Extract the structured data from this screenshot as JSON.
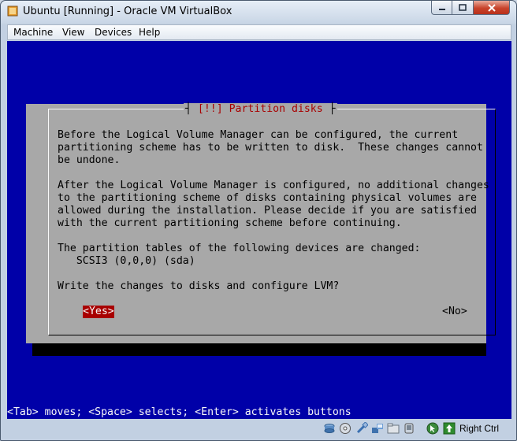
{
  "window": {
    "title": "Ubuntu [Running] - Oracle VM VirtualBox",
    "menu": [
      "Machine",
      "View",
      "Devices",
      "Help"
    ]
  },
  "dialog": {
    "title": "[!!] Partition disks",
    "lines": [
      "Before the Logical Volume Manager can be configured, the current",
      "partitioning scheme has to be written to disk.  These changes cannot",
      "be undone.",
      "",
      "After the Logical Volume Manager is configured, no additional changes",
      "to the partitioning scheme of disks containing physical volumes are",
      "allowed during the installation. Please decide if you are satisfied",
      "with the current partitioning scheme before continuing.",
      "",
      "The partition tables of the following devices are changed:",
      "   SCSI3 (0,0,0) (sda)",
      "",
      "Write the changes to disks and configure LVM?"
    ],
    "yes_label": "<Yes>",
    "no_label": "<No>"
  },
  "help_line": "<Tab> moves; <Space> selects; <Enter> activates buttons",
  "statusbar": {
    "icons": [
      "hard-disk-icon",
      "optical-disk-icon",
      "usb-icon",
      "network-icon",
      "shared-folder-icon",
      "capture-icon",
      "mouse-integration-icon",
      "host-key-icon"
    ],
    "host_key_label": "Right Ctrl"
  }
}
